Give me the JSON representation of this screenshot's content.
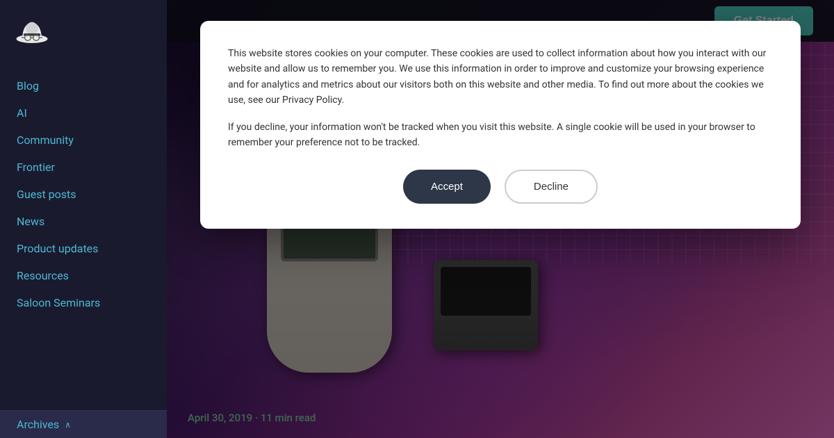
{
  "sidebar": {
    "logo_alt": "Saloon Logo",
    "nav_items": [
      {
        "label": "Blog",
        "id": "blog"
      },
      {
        "label": "AI",
        "id": "ai"
      },
      {
        "label": "Community",
        "id": "community"
      },
      {
        "label": "Frontier",
        "id": "frontier"
      },
      {
        "label": "Guest posts",
        "id": "guest-posts"
      },
      {
        "label": "News",
        "id": "news"
      },
      {
        "label": "Product updates",
        "id": "product-updates"
      },
      {
        "label": "Resources",
        "id": "resources"
      },
      {
        "label": "Saloon Seminars",
        "id": "saloon-seminars"
      }
    ],
    "archives_label": "Archives",
    "archives_chevron": "∧"
  },
  "header": {
    "get_started_label": "Get Started"
  },
  "hero": {
    "date": "April 30, 2019",
    "read_time": "11 min read",
    "date_separator": "·"
  },
  "cookie_modal": {
    "paragraph1": "This website stores cookies on your computer. These cookies are used to collect information about how you interact with our website and allow us to remember you. We use this information in order to improve and customize your browsing experience and for analytics and metrics about our visitors both on this website and other media. To find out more about the cookies we use, see our Privacy Policy.",
    "paragraph2": "If you decline, your information won't be tracked when you visit this website. A single cookie will be used in your browser to remember your preference not to be tracked.",
    "accept_label": "Accept",
    "decline_label": "Decline"
  }
}
